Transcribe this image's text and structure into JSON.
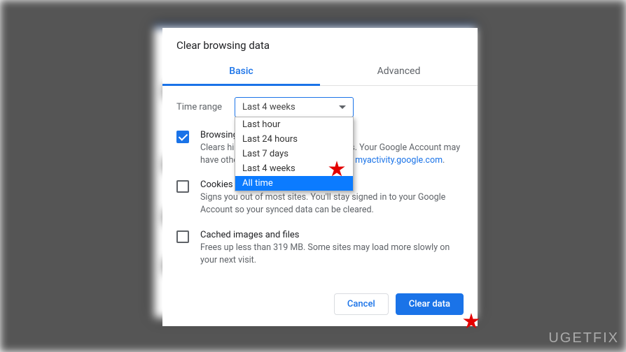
{
  "dialog": {
    "title": "Clear browsing data",
    "tabs": {
      "basic": "Basic",
      "advanced": "Advanced"
    },
    "time_range_label": "Time range",
    "time_range_value": "Last 4 weeks",
    "dropdown_options": [
      "Last hour",
      "Last 24 hours",
      "Last 7 days",
      "Last 4 weeks",
      "All time"
    ],
    "dropdown_selected_index": 4,
    "items": [
      {
        "title": "Browsing history",
        "desc_pre": "Clears history from all signed-in devices. Your Google Account may have other forms of browsing history at ",
        "desc_link": "myactivity.google.com",
        "desc_post": ".",
        "checked": true
      },
      {
        "title": "Cookies and other site data",
        "desc": "Signs you out of most sites. You'll stay signed in to your Google Account so your synced data can be cleared.",
        "checked": false
      },
      {
        "title": "Cached images and files",
        "desc": "Frees up less than 319 MB. Some sites may load more slowly on your next visit.",
        "checked": false
      }
    ],
    "buttons": {
      "cancel": "Cancel",
      "clear": "Clear data"
    }
  },
  "watermark": "UGETFIX"
}
